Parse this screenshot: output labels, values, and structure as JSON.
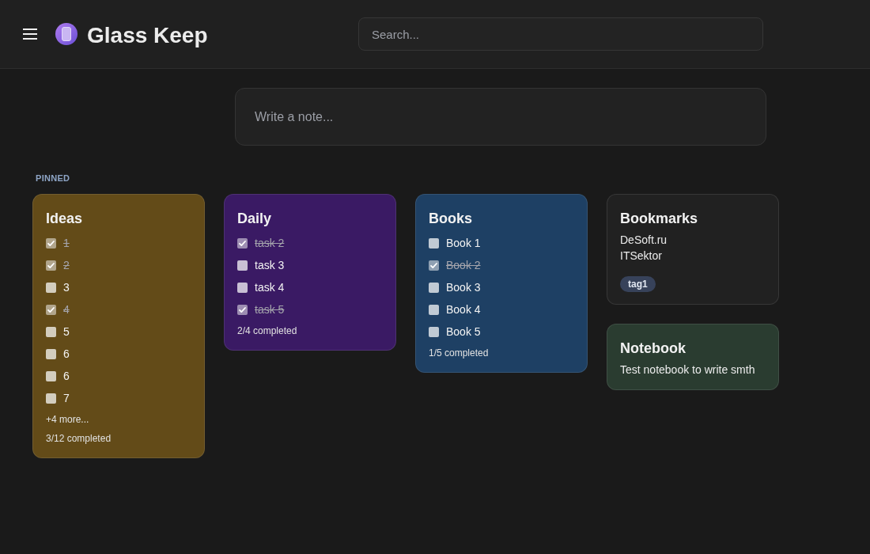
{
  "header": {
    "title": "Glass Keep",
    "search": {
      "placeholder": "Search..."
    }
  },
  "composer": {
    "placeholder": "Write a note..."
  },
  "section": {
    "label": "PINNED"
  },
  "notes": [
    {
      "kind": "checklist",
      "title": "Ideas",
      "color": "#634b18",
      "items": [
        {
          "text": "1",
          "checked": true
        },
        {
          "text": "2",
          "checked": true
        },
        {
          "text": "3",
          "checked": false
        },
        {
          "text": "4",
          "checked": true
        },
        {
          "text": "5",
          "checked": false
        },
        {
          "text": "6",
          "checked": false
        },
        {
          "text": "6",
          "checked": false
        },
        {
          "text": "7",
          "checked": false
        }
      ],
      "more": "+4 more...",
      "progress": "3/12 completed"
    },
    {
      "kind": "checklist",
      "title": "Daily",
      "color": "#3a1a64",
      "items": [
        {
          "text": "task 2",
          "checked": true
        },
        {
          "text": "task 3",
          "checked": false
        },
        {
          "text": "task 4",
          "checked": false
        },
        {
          "text": "task 5",
          "checked": true
        }
      ],
      "progress": "2/4 completed"
    },
    {
      "kind": "checklist",
      "title": "Books",
      "color": "#1e4064",
      "items": [
        {
          "text": "Book 1",
          "checked": false
        },
        {
          "text": "Book 2",
          "checked": true
        },
        {
          "text": "Book 3",
          "checked": false
        },
        {
          "text": "Book 4",
          "checked": false
        },
        {
          "text": "Book 5",
          "checked": false
        }
      ],
      "progress": "1/5 completed"
    },
    {
      "kind": "text",
      "title": "Bookmarks",
      "color": "#212121",
      "lines": [
        "DeSoft.ru",
        "ITSektor"
      ],
      "tags": [
        "tag1"
      ]
    },
    {
      "kind": "text",
      "title": "Notebook",
      "color": "#2a3c30",
      "lines": [
        "Test notebook to write smth"
      ]
    }
  ]
}
